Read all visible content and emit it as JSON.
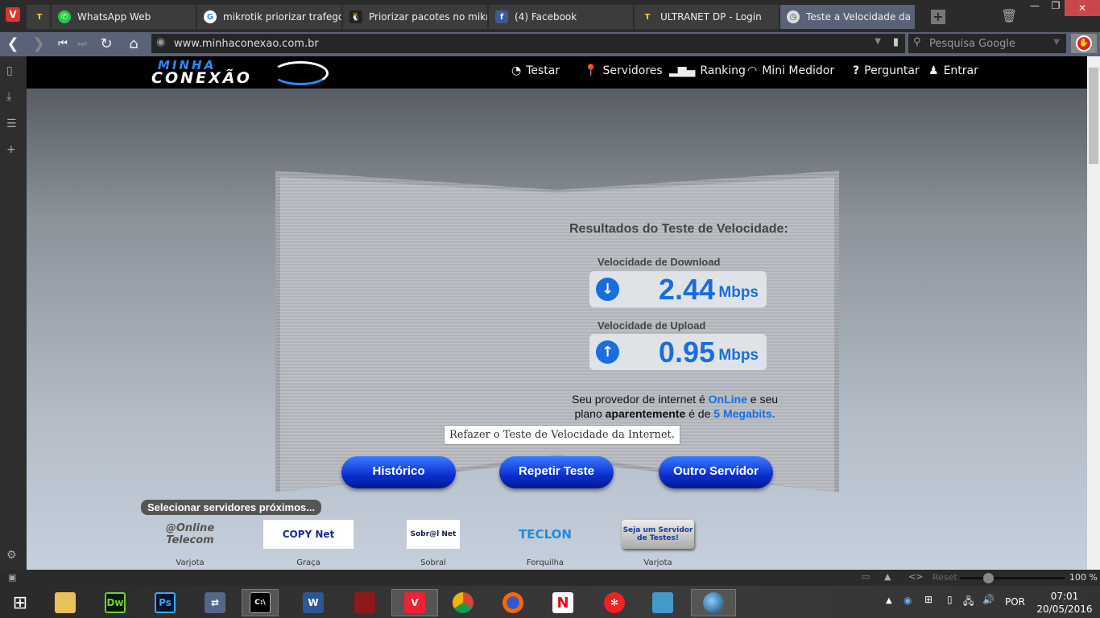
{
  "browser": {
    "tabs": [
      {
        "label": "",
        "icon": "ultranet-icon"
      },
      {
        "label": "WhatsApp Web",
        "icon": "whatsapp-icon"
      },
      {
        "label": "mikrotik priorizar trafego - Google",
        "icon": "google-icon"
      },
      {
        "label": "Priorizar pacotes no mikrotik",
        "icon": "linux-penguin-icon"
      },
      {
        "label": "(4) Facebook",
        "icon": "facebook-icon"
      },
      {
        "label": "ULTRANET DP - Login",
        "icon": "ultranet-icon"
      },
      {
        "label": "Teste a Velocidade da Internet",
        "icon": "speedometer-icon",
        "active": true
      }
    ],
    "url": "www.minhaconexao.com.br",
    "search_placeholder": "Pesquisa Google",
    "zoom_reset": "Reset",
    "zoom_level": "100 %",
    "zoom_fraction": 0.27
  },
  "site": {
    "logo_top": "MINHA",
    "logo_bottom": "CONEXÃO",
    "menu": [
      "Testar",
      "Servidores",
      "Ranking",
      "Mini Medidor",
      "Perguntar",
      "Entrar"
    ],
    "results_title": "Resultados do Teste de Velocidade:",
    "download_label": "Velocidade de Download",
    "download_value": "2.44",
    "download_unit": "Mbps",
    "upload_label": "Velocidade de Upload",
    "upload_value": "0.95",
    "upload_unit": "Mbps",
    "provider_pre": "Seu provedor de internet é ",
    "provider": "OnLine",
    "provider_mid": " e seu",
    "plan_pre": "plano ",
    "plan_bold": "aparentemente",
    "plan_mid": " é de ",
    "plan": "5 Megabits.",
    "tooltip": "Refazer o Teste de Velocidade da Internet.",
    "buttons": [
      "Histórico",
      "Repetir Teste",
      "Outro Servidor"
    ],
    "servers_header": "Selecionar servidores próximos...",
    "servers": [
      {
        "logo": "@Online Telecom",
        "name": "Varjota"
      },
      {
        "logo": "COPY Net",
        "name": "Graça"
      },
      {
        "logo": "Sobr@l Net",
        "name": "Sobral"
      },
      {
        "logo": "TECLON",
        "name": "Forquilha"
      },
      {
        "logo": "Seja um Servidor de Testes!",
        "name": "Varjota"
      }
    ],
    "accent": "#1a6ce0"
  },
  "taskbar": {
    "apps": [
      "file-explorer",
      "dreamweaver",
      "photoshop",
      "network",
      "cmd",
      "word",
      "dota2",
      "vivaldi",
      "chrome",
      "firefox",
      "netflix",
      "app",
      "control-panel",
      "globe"
    ],
    "dw": "Dw",
    "ps": "Ps",
    "w": "W",
    "n": "N",
    "lang": "POR",
    "time": "07:01",
    "date": "20/05/2016"
  }
}
